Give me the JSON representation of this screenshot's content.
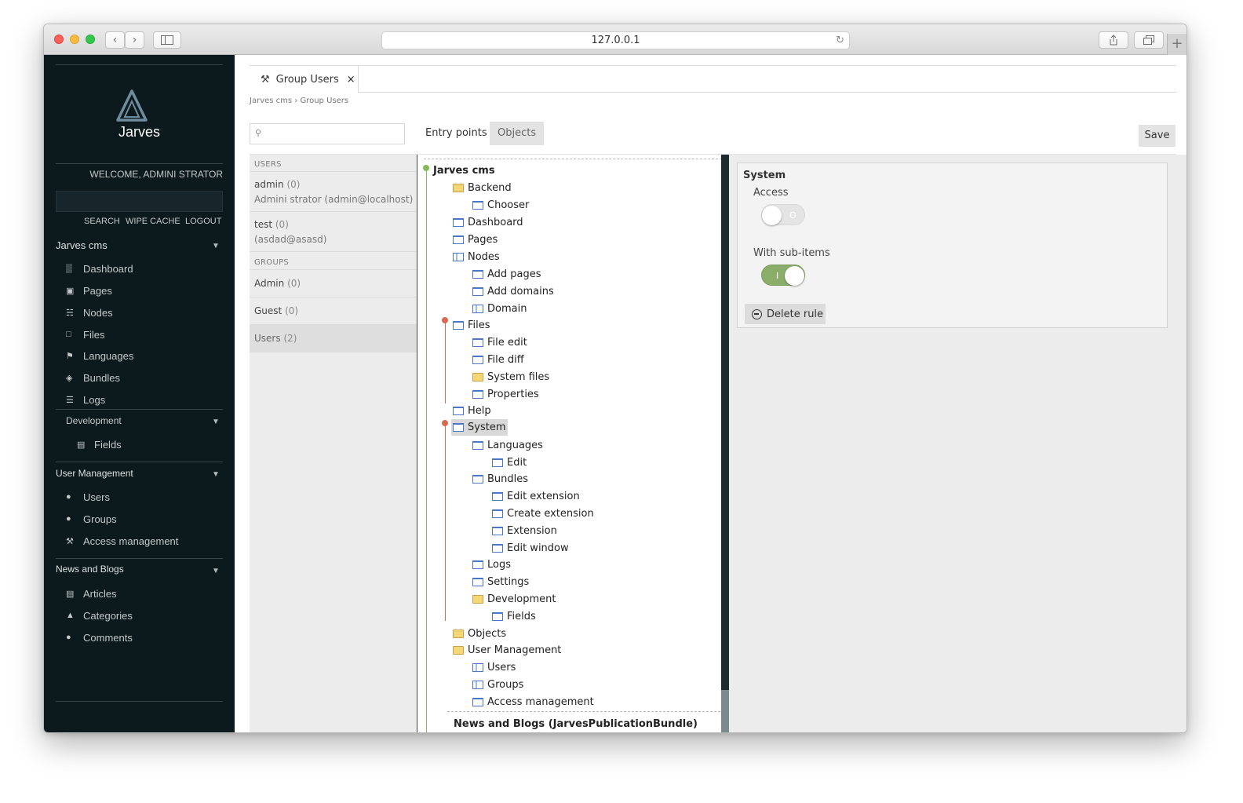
{
  "browser": {
    "url": "127.0.0.1"
  },
  "sidebar": {
    "app_name": "Jarves",
    "welcome": "WELCOME, ADMINI STRATOR",
    "actions": [
      "SEARCH",
      "WIPE CACHE",
      "LOGOUT"
    ],
    "sections": [
      {
        "label": "Jarves cms",
        "items": [
          {
            "label": "Dashboard",
            "icon": "dashboard-icon"
          },
          {
            "label": "Pages",
            "icon": "monitor-icon"
          },
          {
            "label": "Nodes",
            "icon": "sitemap-icon"
          },
          {
            "label": "Files",
            "icon": "folder-icon"
          },
          {
            "label": "Languages",
            "icon": "flag-icon"
          },
          {
            "label": "Bundles",
            "icon": "box-icon"
          },
          {
            "label": "Logs",
            "icon": "list-icon"
          }
        ]
      },
      {
        "label": "Development",
        "items": [
          {
            "label": "Fields",
            "icon": "fields-icon"
          }
        ]
      },
      {
        "label": "User Management",
        "items": [
          {
            "label": "Users",
            "icon": "user-icon"
          },
          {
            "label": "Groups",
            "icon": "users-icon"
          },
          {
            "label": "Access management",
            "icon": "wrench-icon"
          }
        ]
      },
      {
        "label": "News and Blogs",
        "items": [
          {
            "label": "Articles",
            "icon": "newspaper-icon"
          },
          {
            "label": "Categories",
            "icon": "inbox-icon"
          },
          {
            "label": "Comments",
            "icon": "comment-icon"
          }
        ]
      }
    ]
  },
  "tab": {
    "label": "Group Users",
    "close": "×"
  },
  "breadcrumb": "Jarves cms › Group Users",
  "toolbar": {
    "entry_points": "Entry points",
    "objects": "Objects",
    "save": "Save"
  },
  "users_panel": {
    "users_header": "USERS",
    "users": [
      {
        "name": "admin",
        "count": "(0)",
        "detail": "Admini strator (admin@localhost)"
      },
      {
        "name": "test",
        "count": "(0)",
        "detail": "(asdad@asasd)"
      }
    ],
    "groups_header": "GROUPS",
    "groups": [
      {
        "name": "Admin",
        "count": "(0)"
      },
      {
        "name": "Guest",
        "count": "(0)"
      },
      {
        "name": "Users",
        "count": "(2)"
      }
    ]
  },
  "tree": {
    "root": "Jarves cms",
    "nodes": [
      "Backend",
      "Chooser",
      "Dashboard",
      "Pages",
      "Nodes",
      "Add pages",
      "Add domains",
      "Domain",
      "Files",
      "File edit",
      "File diff",
      "System files",
      "Properties",
      "Help",
      "System",
      "Languages",
      "Edit",
      "Bundles",
      "Edit extension",
      "Create extension",
      "Extension",
      "Edit window",
      "Logs",
      "Settings",
      "Development",
      "Fields",
      "Objects",
      "User Management",
      "Users",
      "Groups",
      "Access management"
    ],
    "next_root": "News and Blogs (JarvesPublicationBundle)"
  },
  "rule": {
    "title": "System",
    "access_label": "Access",
    "access_toggle": "O",
    "sub_label": "With sub-items",
    "sub_toggle": "I",
    "delete": "Delete rule"
  },
  "colors": {
    "sidebar_bg": "#0c1a1d",
    "toggle_on": "#8aad6a",
    "rule_marker": "#d96a52",
    "root_marker": "#86b85a"
  }
}
